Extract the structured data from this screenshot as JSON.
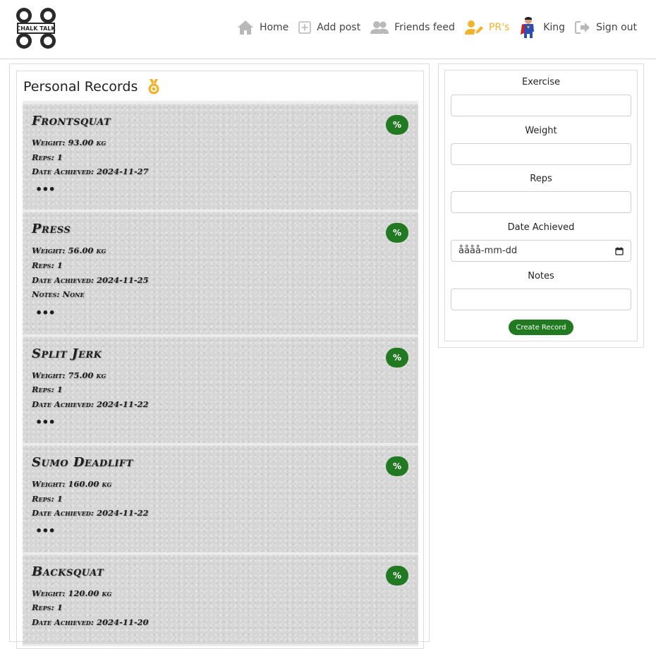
{
  "nav": {
    "home": "Home",
    "add_post": "Add post",
    "friends_feed": "Friends feed",
    "prs": "PR's",
    "user": "King",
    "sign_out": "Sign out",
    "active_color": "#f0b32d"
  },
  "logo": {
    "text": "CHALK TALK"
  },
  "records": {
    "title": "Personal Records",
    "items": [
      {
        "name": "Frontsquat",
        "weight": "Weight: 93.00 kg",
        "reps": "Reps: 1",
        "date": "Date Achieved: 2024-11-27",
        "notes": "",
        "more": "•••",
        "pct": "%"
      },
      {
        "name": "Press",
        "weight": "Weight: 56.00 kg",
        "reps": "Reps: 1",
        "date": "Date Achieved: 2024-11-25",
        "notes": "Notes: None",
        "more": "•••",
        "pct": "%"
      },
      {
        "name": "Split Jerk",
        "weight": "Weight: 75.00 kg",
        "reps": "Reps: 1",
        "date": "Date Achieved: 2024-11-22",
        "notes": "",
        "more": "•••",
        "pct": "%"
      },
      {
        "name": "Sumo Deadlift",
        "weight": "Weight: 160.00 kg",
        "reps": "Reps: 1",
        "date": "Date Achieved: 2024-11-22",
        "notes": "",
        "more": "•••",
        "pct": "%"
      },
      {
        "name": "Backsquat",
        "weight": "Weight: 120.00 kg",
        "reps": "Reps: 1",
        "date": "Date Achieved: 2024-11-20",
        "notes": "",
        "more": "•••",
        "pct": "%"
      }
    ]
  },
  "form": {
    "exercise_label": "Exercise",
    "weight_label": "Weight",
    "reps_label": "Reps",
    "date_label": "Date Achieved",
    "date_placeholder": "åååå-mm-dd",
    "notes_label": "Notes",
    "submit": "Create Record"
  },
  "colors": {
    "button_green": "#217a21",
    "accent": "#f0b32d"
  }
}
